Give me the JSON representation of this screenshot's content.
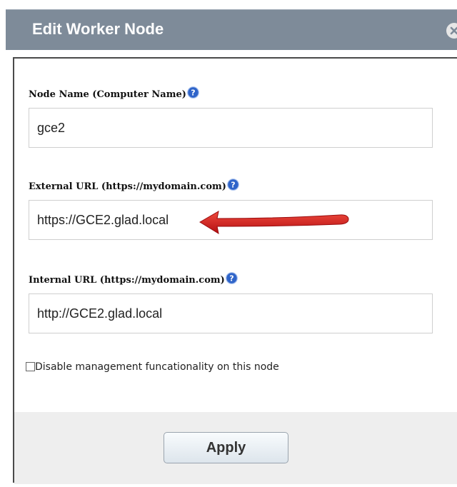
{
  "dialog": {
    "title": "Edit Worker Node",
    "close_icon": "close-icon"
  },
  "fields": {
    "node_name": {
      "label": "Node Name (Computer Name)",
      "value": "gce2"
    },
    "external_url": {
      "label": "External URL (https://mydomain.com)",
      "value": "https://GCE2.glad.local"
    },
    "internal_url": {
      "label": "Internal URL (https://mydomain.com)",
      "value": "http://GCE2.glad.local"
    }
  },
  "options": {
    "disable_management_label": "Disable management funcationality on this node",
    "disable_management_checked": false
  },
  "footer": {
    "apply_label": "Apply"
  },
  "colors": {
    "titlebar": "#7e8b99",
    "help_icon": "#2f64c9",
    "annotation_arrow": "#d8191b"
  }
}
